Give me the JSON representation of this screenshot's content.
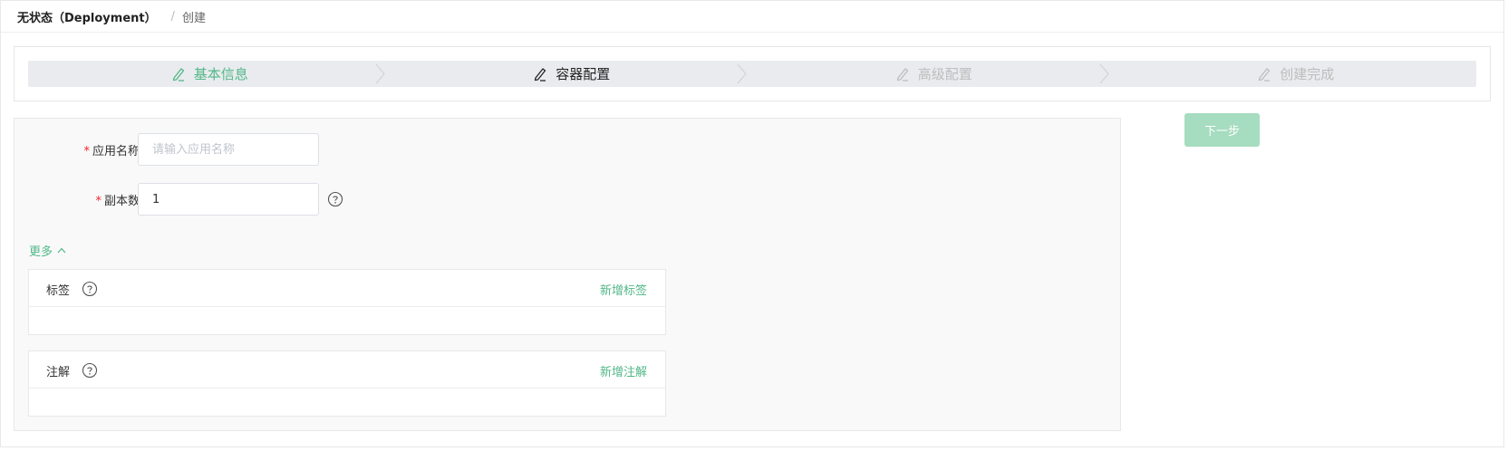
{
  "breadcrumb": {
    "root": "无状态（Deployment）",
    "separator": "/",
    "current": "创建"
  },
  "steps": [
    {
      "label": "基本信息",
      "state": "done",
      "icon": "edit-icon"
    },
    {
      "label": "容器配置",
      "state": "active",
      "icon": "edit-icon"
    },
    {
      "label": "高级配置",
      "state": "todo",
      "icon": "edit-icon"
    },
    {
      "label": "创建完成",
      "state": "todo",
      "icon": "edit-icon"
    }
  ],
  "form": {
    "app_name": {
      "label": "应用名称",
      "value": "",
      "placeholder": "请输入应用名称",
      "required": true
    },
    "replicas": {
      "label": "副本数",
      "value": "1",
      "required": true,
      "help_icon": "question-circle-icon"
    },
    "more_label": "更多",
    "labels_card": {
      "title": "标签",
      "add_label": "新增标签",
      "help_icon": "question-circle-icon"
    },
    "annotations_card": {
      "title": "注解",
      "add_label": "新增注解",
      "help_icon": "question-circle-icon"
    }
  },
  "actions": {
    "next_label": "下一步"
  },
  "colors": {
    "accent": "#52b788",
    "next_button_disabled": "#a6dcc0",
    "required_star": "#f5222d",
    "steps_bg": "#e9ebee"
  }
}
